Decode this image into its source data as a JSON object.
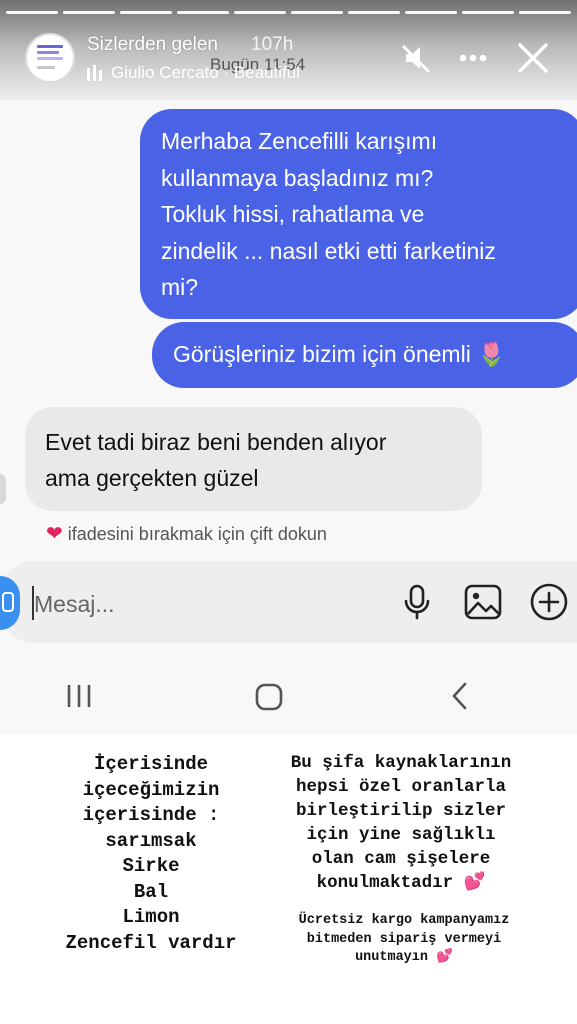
{
  "story": {
    "user": "Sizlerden gelen",
    "age": "107h",
    "music": "Giulio Cercato · Beautiful",
    "segments": 10,
    "icons": [
      "mute-icon",
      "more-icon",
      "close-icon"
    ]
  },
  "chat": {
    "timestamp": "Bugün 11:54",
    "outgoing_1": [
      "Merhaba Zencefilli karışımı",
      "kullanmaya başladınız mı?",
      "Tokluk hissi, rahatlama ve",
      "zindelik ... nasıl etki etti farketiniz",
      "mi?"
    ],
    "outgoing_2": "Görüşleriniz bizim için önemli 🌷",
    "incoming": [
      "Evet tadi biraz beni benden alıyor",
      "ama gerçekten güzel"
    ],
    "reaction_hint": "ifadesini bırakmak için çift dokun",
    "reaction_heart": "❤",
    "composer_placeholder": "Mesaj...",
    "colors": {
      "outgoing": "#4a63e6",
      "incoming": "#e9e9ea",
      "camera": "#3a8ff0"
    }
  },
  "overlay": {
    "left_lines": [
      "İçerisinde",
      "içeceğimizin",
      "içerisinde :",
      "sarımsak",
      "Sirke",
      "Bal",
      "Limon",
      "Zencefil vardır"
    ],
    "right_lines": [
      "Bu şifa kaynaklarının",
      "hepsi özel oranlarla",
      "birleştirilip sizler",
      "için yine sağlıklı",
      "olan cam şişelere",
      "konulmaktadır 💕"
    ],
    "note_lines": [
      "Ücretsiz kargo kampanyamız",
      "bitmeden sipariş vermeyi",
      "unutmayın 💕"
    ]
  }
}
